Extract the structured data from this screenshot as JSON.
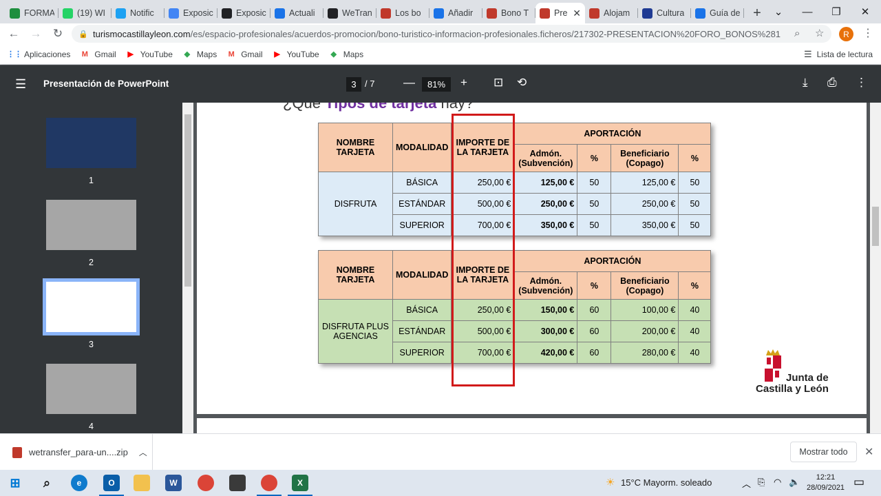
{
  "browser": {
    "tabs": [
      {
        "label": "FORMA",
        "icon": "google-drive-icon",
        "color": "#1e8e3e"
      },
      {
        "label": "(19) WI",
        "icon": "whatsapp-icon",
        "color": "#25d366"
      },
      {
        "label": "Notific",
        "icon": "twitter-icon",
        "color": "#1da1f2"
      },
      {
        "label": "Exposic",
        "icon": "google-icon",
        "color": "#4285f4"
      },
      {
        "label": "Exposic",
        "icon": "arrow-logo-icon",
        "color": "#202124"
      },
      {
        "label": "Actuali",
        "icon": "cyl-site-icon",
        "color": "#1a73e8"
      },
      {
        "label": "WeTran",
        "icon": "wetransfer-icon",
        "color": "#202124"
      },
      {
        "label": "Los bo",
        "icon": "cyl-tourism-icon",
        "color": "#c0392b"
      },
      {
        "label": "Añadir",
        "icon": "cyl-site-icon",
        "color": "#1a73e8"
      },
      {
        "label": "Bono T",
        "icon": "cyl-tourism-icon",
        "color": "#c0392b"
      },
      {
        "label": "Pre",
        "icon": "cyl-tourism-icon",
        "color": "#c0392b",
        "active": true
      },
      {
        "label": "Alojam",
        "icon": "cyl-tourism-icon",
        "color": "#c0392b"
      },
      {
        "label": "Cultura",
        "icon": "cultura-icon",
        "color": "#1f3a93"
      },
      {
        "label": "Guía de",
        "icon": "cyl-site-icon",
        "color": "#1a73e8"
      }
    ],
    "url_host": "turismocastillayleon.com",
    "url_path": "/es/espacio-profesionales/acuerdos-promocion/bono-turistico-informacion-profesionales.ficheros/217302-PRESENTACION%20FORO_BONOS%281...",
    "avatar_letter": "R",
    "bookmarks": [
      {
        "label": "Aplicaciones",
        "icon": "apps-grid-icon"
      },
      {
        "label": "Gmail",
        "icon": "gmail-icon"
      },
      {
        "label": "YouTube",
        "icon": "youtube-icon"
      },
      {
        "label": "Maps",
        "icon": "maps-icon"
      },
      {
        "label": "Gmail",
        "icon": "gmail-icon"
      },
      {
        "label": "YouTube",
        "icon": "youtube-icon"
      },
      {
        "label": "Maps",
        "icon": "maps-icon"
      }
    ],
    "reading_list": "Lista de lectura"
  },
  "pdf": {
    "title": "Presentación de PowerPoint",
    "page": "3",
    "page_total": "/  7",
    "zoom": "81%",
    "thumbnails": [
      {
        "num": "1",
        "color": "#203864"
      },
      {
        "num": "2",
        "color": "#a6a6a6"
      },
      {
        "num": "3",
        "color": "#ffffff",
        "selected": true
      },
      {
        "num": "4",
        "color": "#a6a6a6"
      }
    ]
  },
  "slide": {
    "heading_prefix": "¿Qué",
    "heading_highlight": "Tipos de tarjeta",
    "heading_suffix": "hay?",
    "tables": [
      {
        "col_headers": {
          "nombre": "NOMBRE TARJETA",
          "modalidad": "MODALIDAD",
          "importe": "IMPORTE DE LA TARJETA",
          "aportacion": "APORTACIÓN",
          "admon": "Admón. (Subvención)",
          "pct1": "%",
          "benef": "Beneficiario (Copago)",
          "pct2": "%"
        },
        "card_name": "DISFRUTA",
        "rows": [
          {
            "modalidad": "BÁSICA",
            "importe": "250,00 €",
            "admon": "125,00 €",
            "pct1": "50",
            "benef": "125,00 €",
            "pct2": "50"
          },
          {
            "modalidad": "ESTÁNDAR",
            "importe": "500,00 €",
            "admon": "250,00 €",
            "pct1": "50",
            "benef": "250,00 €",
            "pct2": "50"
          },
          {
            "modalidad": "SUPERIOR",
            "importe": "700,00 €",
            "admon": "350,00 €",
            "pct1": "50",
            "benef": "350,00 €",
            "pct2": "50"
          }
        ]
      },
      {
        "col_headers": {
          "nombre": "NOMBRE TARJETA",
          "modalidad": "MODALIDAD",
          "importe": "IMPORTE DE LA TARJETA",
          "aportacion": "APORTACIÓN",
          "admon": "Admón. (Subvención)",
          "pct1": "%",
          "benef": "Beneficiario (Copago)",
          "pct2": "%"
        },
        "card_name": "DISFRUTA PLUS AGENCIAS",
        "rows": [
          {
            "modalidad": "BÁSICA",
            "importe": "250,00 €",
            "admon": "150,00 €",
            "pct1": "60",
            "benef": "100,00 €",
            "pct2": "40"
          },
          {
            "modalidad": "ESTÁNDAR",
            "importe": "500,00 €",
            "admon": "300,00 €",
            "pct1": "60",
            "benef": "200,00 €",
            "pct2": "40"
          },
          {
            "modalidad": "SUPERIOR",
            "importe": "700,00 €",
            "admon": "420,00 €",
            "pct1": "60",
            "benef": "280,00 €",
            "pct2": "40"
          }
        ]
      }
    ],
    "logo_line1": "Junta de",
    "logo_line2": "Castilla y León"
  },
  "download": {
    "filename": "wetransfer_para-un....zip",
    "show_all": "Mostrar todo"
  },
  "taskbar": {
    "weather": "15°C  Mayorm. soleado",
    "time": "12:21",
    "date": "28/09/2021"
  }
}
